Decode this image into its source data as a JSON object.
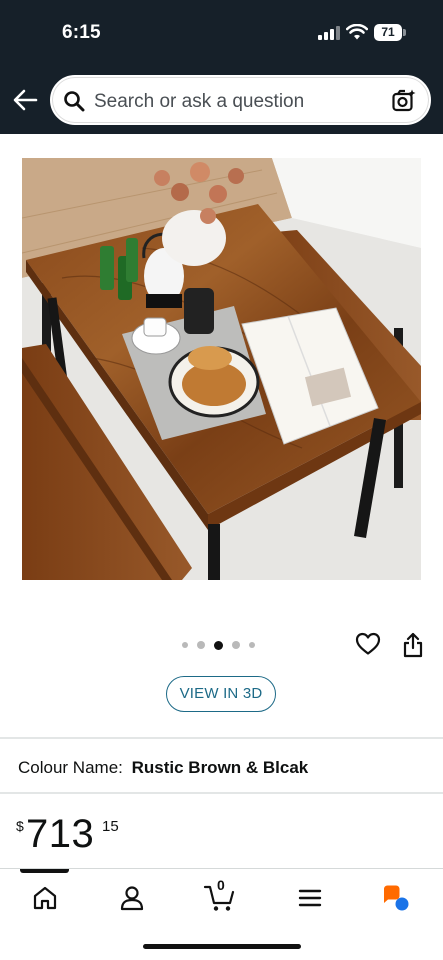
{
  "status_bar": {
    "time": "6:15",
    "battery": "71"
  },
  "header": {
    "search_placeholder": "Search or ask a question"
  },
  "product": {
    "image_alt": "Rustic brown dining table with benches",
    "carousel": {
      "count": 5,
      "active_index": 2
    },
    "view_3d_label": "VIEW IN 3D",
    "colour_label": "Colour Name:",
    "colour_value": "Rustic Brown & Blcak",
    "price": {
      "symbol": "$",
      "whole": "713",
      "fraction": "15"
    }
  },
  "bottom_nav": {
    "cart_count": "0",
    "items": [
      "home-icon",
      "account-icon",
      "cart-icon",
      "menu-icon",
      "assistant-icon"
    ]
  },
  "colors": {
    "header_bg": "#162029",
    "accent_link": "#1d6a87",
    "assistant_orange": "#ff6a00",
    "assistant_blue": "#1a73e8"
  }
}
